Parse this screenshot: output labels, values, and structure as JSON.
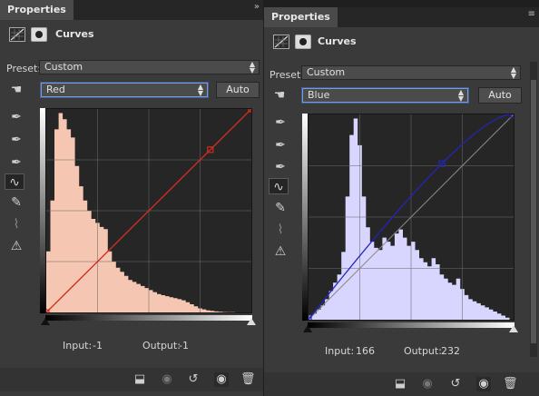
{
  "left": {
    "tab": "Properties",
    "header_title": "Curves",
    "preset_label": "Preset:",
    "preset_value": "Custom",
    "channel_value": "Red",
    "auto_label": "Auto",
    "input_label": "Input:",
    "input_value": "-1",
    "output_label": "Output:",
    "output_value": "-1",
    "curve_color": "#d42a1e",
    "histogram_color": "#f5c6b2",
    "histogram": [
      0.3,
      0.55,
      0.9,
      0.98,
      0.95,
      0.9,
      0.86,
      0.72,
      0.62,
      0.55,
      0.5,
      0.46,
      0.44,
      0.42,
      0.41,
      0.3,
      0.25,
      0.22,
      0.2,
      0.18,
      0.16,
      0.15,
      0.14,
      0.13,
      0.12,
      0.11,
      0.1,
      0.09,
      0.085,
      0.08,
      0.075,
      0.07,
      0.065,
      0.06,
      0.05,
      0.04,
      0.03,
      0.02,
      0.015,
      0.01,
      0.008,
      0.005,
      0.003,
      0.002,
      0.001,
      0.001,
      0,
      0,
      0,
      0
    ],
    "curve_points": [
      [
        0,
        0
      ],
      [
        0.8,
        0.8
      ],
      [
        1,
        1
      ]
    ]
  },
  "right": {
    "tab": "Properties",
    "header_title": "Curves",
    "preset_label": "Preset:",
    "preset_value": "Custom",
    "channel_value": "Blue",
    "auto_label": "Auto",
    "input_label": "Input:",
    "input_value": "166",
    "output_label": "Output:",
    "output_value": "232",
    "curve_color": "#2226b8",
    "histogram_color": "#d8d5ff",
    "histogram": [
      0.02,
      0.03,
      0.05,
      0.07,
      0.1,
      0.14,
      0.18,
      0.22,
      0.33,
      0.6,
      0.9,
      0.98,
      0.85,
      0.6,
      0.45,
      0.38,
      0.35,
      0.34,
      0.4,
      0.38,
      0.36,
      0.42,
      0.44,
      0.4,
      0.36,
      0.38,
      0.34,
      0.3,
      0.28,
      0.26,
      0.3,
      0.27,
      0.22,
      0.2,
      0.18,
      0.17,
      0.2,
      0.15,
      0.12,
      0.1,
      0.09,
      0.08,
      0.07,
      0.06,
      0.05,
      0.04,
      0.03,
      0.02,
      0.01,
      0
    ],
    "curve_points": [
      [
        0,
        0
      ],
      [
        0.65,
        0.76
      ],
      [
        1,
        1
      ]
    ]
  }
}
